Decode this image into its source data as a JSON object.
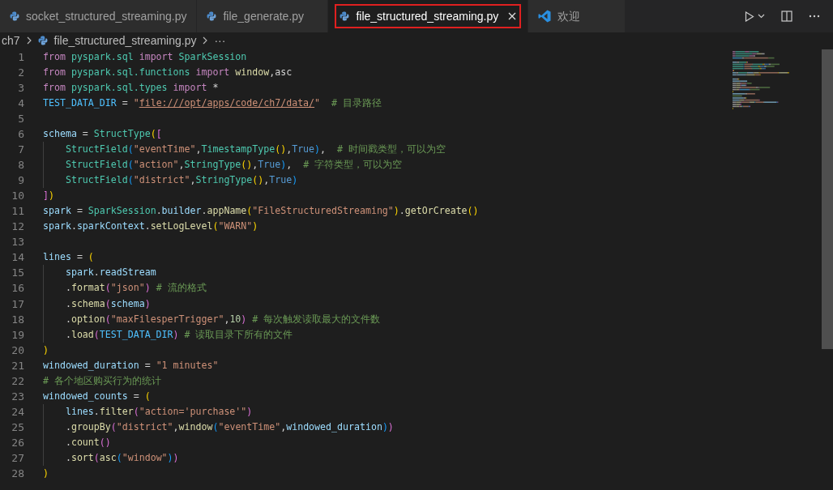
{
  "tabs": [
    {
      "label": "socket_structured_streaming.py",
      "kind": "file",
      "selected": false,
      "closable": false,
      "outlined": false
    },
    {
      "label": "file_generate.py",
      "kind": "file",
      "selected": false,
      "closable": false,
      "outlined": false
    },
    {
      "label": "file_structured_streaming.py",
      "kind": "file",
      "selected": true,
      "closable": true,
      "outlined": true
    },
    {
      "label": "欢迎",
      "kind": "welcome",
      "selected": false,
      "closable": false,
      "outlined": false
    }
  ],
  "breadcrumbs": {
    "folder": "ch7",
    "file": "file_structured_streaming.py",
    "more": "···"
  },
  "lines": [
    {
      "n": "1",
      "tokens": [
        {
          "t": "from",
          "kind": "kw"
        },
        {
          "t": " pyspark.sql ",
          "kind": "mod"
        },
        {
          "t": "import",
          "kind": "kw"
        },
        {
          "t": " SparkSession",
          "kind": "cls"
        }
      ]
    },
    {
      "n": "2",
      "tokens": [
        {
          "t": "from",
          "kind": "kw"
        },
        {
          "t": " pyspark.sql.functions ",
          "kind": "mod"
        },
        {
          "t": "import",
          "kind": "kw"
        },
        {
          "t": " window",
          "kind": "fn"
        },
        {
          "t": ",asc",
          "kind": "plain"
        }
      ]
    },
    {
      "n": "3",
      "tokens": [
        {
          "t": "from",
          "kind": "kw"
        },
        {
          "t": " pyspark.sql.types ",
          "kind": "mod"
        },
        {
          "t": "import",
          "kind": "kw"
        },
        {
          "t": " *",
          "kind": "plain"
        }
      ]
    },
    {
      "n": "4",
      "tokens": [
        {
          "t": "TEST_DATA_DIR",
          "kind": "const"
        },
        {
          "t": " = ",
          "kind": "plain"
        },
        {
          "t": "\"",
          "kind": "str"
        },
        {
          "t": "file:///opt/apps/code/ch7/data/",
          "kind": "link"
        },
        {
          "t": "\"",
          "kind": "str"
        },
        {
          "t": "  # 目录路径",
          "kind": "cm"
        }
      ]
    },
    {
      "n": "5"
    },
    {
      "n": "6",
      "tokens": [
        {
          "t": "schema",
          "kind": "var"
        },
        {
          "t": " = ",
          "kind": "plain"
        },
        {
          "t": "StructType",
          "kind": "cls"
        },
        {
          "t": "(",
          "kind": "b1"
        },
        {
          "t": "[",
          "kind": "b2"
        }
      ]
    },
    {
      "n": "7",
      "tokens": [
        {
          "t": "    StructField",
          "kind": "cls"
        },
        {
          "t": "(",
          "kind": "b3"
        },
        {
          "t": "\"eventTime\"",
          "kind": "str"
        },
        {
          "t": ",",
          "kind": "plain"
        },
        {
          "t": "TimestampType",
          "kind": "cls"
        },
        {
          "t": "()",
          "kind": "b1"
        },
        {
          "t": ",",
          "kind": "plain"
        },
        {
          "t": "True",
          "kind": "kwb"
        },
        {
          "t": ")",
          "kind": "b3"
        },
        {
          "t": ",  ",
          "kind": "plain"
        },
        {
          "t": "# 时间戳类型，可以为空",
          "kind": "cm"
        }
      ]
    },
    {
      "n": "8",
      "tokens": [
        {
          "t": "    StructField",
          "kind": "cls"
        },
        {
          "t": "(",
          "kind": "b3"
        },
        {
          "t": "\"action\"",
          "kind": "str"
        },
        {
          "t": ",",
          "kind": "plain"
        },
        {
          "t": "StringType",
          "kind": "cls"
        },
        {
          "t": "()",
          "kind": "b1"
        },
        {
          "t": ",",
          "kind": "plain"
        },
        {
          "t": "True",
          "kind": "kwb"
        },
        {
          "t": ")",
          "kind": "b3"
        },
        {
          "t": ",  ",
          "kind": "plain"
        },
        {
          "t": "# 字符类型，可以为空",
          "kind": "cm"
        }
      ]
    },
    {
      "n": "9",
      "tokens": [
        {
          "t": "    StructField",
          "kind": "cls"
        },
        {
          "t": "(",
          "kind": "b3"
        },
        {
          "t": "\"district\"",
          "kind": "str"
        },
        {
          "t": ",",
          "kind": "plain"
        },
        {
          "t": "StringType",
          "kind": "cls"
        },
        {
          "t": "()",
          "kind": "b1"
        },
        {
          "t": ",",
          "kind": "plain"
        },
        {
          "t": "True",
          "kind": "kwb"
        },
        {
          "t": ")",
          "kind": "b3"
        }
      ]
    },
    {
      "n": "10",
      "tokens": [
        {
          "t": "]",
          "kind": "b2"
        },
        {
          "t": ")",
          "kind": "b1"
        }
      ]
    },
    {
      "n": "11",
      "tokens": [
        {
          "t": "spark",
          "kind": "var"
        },
        {
          "t": " = ",
          "kind": "plain"
        },
        {
          "t": "SparkSession",
          "kind": "cls"
        },
        {
          "t": ".",
          "kind": "plain"
        },
        {
          "t": "builder",
          "kind": "var"
        },
        {
          "t": ".",
          "kind": "plain"
        },
        {
          "t": "appName",
          "kind": "fn"
        },
        {
          "t": "(",
          "kind": "b1"
        },
        {
          "t": "\"FileStructuredStreaming\"",
          "kind": "str"
        },
        {
          "t": ")",
          "kind": "b1"
        },
        {
          "t": ".",
          "kind": "plain"
        },
        {
          "t": "getOrCreate",
          "kind": "fn"
        },
        {
          "t": "()",
          "kind": "b1"
        }
      ]
    },
    {
      "n": "12",
      "tokens": [
        {
          "t": "spark",
          "kind": "var"
        },
        {
          "t": ".",
          "kind": "plain"
        },
        {
          "t": "sparkContext",
          "kind": "var"
        },
        {
          "t": ".",
          "kind": "plain"
        },
        {
          "t": "setLogLevel",
          "kind": "fn"
        },
        {
          "t": "(",
          "kind": "b1"
        },
        {
          "t": "\"WARN\"",
          "kind": "str"
        },
        {
          "t": ")",
          "kind": "b1"
        }
      ]
    },
    {
      "n": "13"
    },
    {
      "n": "14",
      "tokens": [
        {
          "t": "lines",
          "kind": "var"
        },
        {
          "t": " = ",
          "kind": "plain"
        },
        {
          "t": "(",
          "kind": "b1"
        }
      ]
    },
    {
      "n": "15",
      "tokens": [
        {
          "t": "    spark",
          "kind": "var"
        },
        {
          "t": ".",
          "kind": "plain"
        },
        {
          "t": "readStream",
          "kind": "var"
        }
      ]
    },
    {
      "n": "16",
      "tokens": [
        {
          "t": "    .",
          "kind": "plain"
        },
        {
          "t": "format",
          "kind": "fn"
        },
        {
          "t": "(",
          "kind": "b2"
        },
        {
          "t": "\"json\"",
          "kind": "str"
        },
        {
          "t": ")",
          "kind": "b2"
        },
        {
          "t": " # 流的格式",
          "kind": "cm"
        }
      ]
    },
    {
      "n": "17",
      "tokens": [
        {
          "t": "    .",
          "kind": "plain"
        },
        {
          "t": "schema",
          "kind": "fn"
        },
        {
          "t": "(",
          "kind": "b2"
        },
        {
          "t": "schema",
          "kind": "var"
        },
        {
          "t": ")",
          "kind": "b2"
        }
      ]
    },
    {
      "n": "18",
      "tokens": [
        {
          "t": "    .",
          "kind": "plain"
        },
        {
          "t": "option",
          "kind": "fn"
        },
        {
          "t": "(",
          "kind": "b2"
        },
        {
          "t": "\"maxFilesperTrigger\"",
          "kind": "str"
        },
        {
          "t": ",",
          "kind": "plain"
        },
        {
          "t": "10",
          "kind": "num"
        },
        {
          "t": ")",
          "kind": "b2"
        },
        {
          "t": " # 每次触发读取最大的文件数",
          "kind": "cm"
        }
      ]
    },
    {
      "n": "19",
      "tokens": [
        {
          "t": "    .",
          "kind": "plain"
        },
        {
          "t": "load",
          "kind": "fn"
        },
        {
          "t": "(",
          "kind": "b2"
        },
        {
          "t": "TEST_DATA_DIR",
          "kind": "const"
        },
        {
          "t": ")",
          "kind": "b2"
        },
        {
          "t": " # 读取目录下所有的文件",
          "kind": "cm"
        }
      ]
    },
    {
      "n": "20",
      "tokens": [
        {
          "t": ")",
          "kind": "b1"
        }
      ]
    },
    {
      "n": "21",
      "tokens": [
        {
          "t": "windowed_duration",
          "kind": "var"
        },
        {
          "t": " = ",
          "kind": "plain"
        },
        {
          "t": "\"1 minutes\"",
          "kind": "str"
        }
      ]
    },
    {
      "n": "22",
      "tokens": [
        {
          "t": "# 各个地区购买行为的统计",
          "kind": "cm"
        }
      ]
    },
    {
      "n": "23",
      "tokens": [
        {
          "t": "windowed_counts",
          "kind": "var"
        },
        {
          "t": " = ",
          "kind": "plain"
        },
        {
          "t": "(",
          "kind": "b1"
        }
      ]
    },
    {
      "n": "24",
      "tokens": [
        {
          "t": "    lines",
          "kind": "var"
        },
        {
          "t": ".",
          "kind": "plain"
        },
        {
          "t": "filter",
          "kind": "fn"
        },
        {
          "t": "(",
          "kind": "b2"
        },
        {
          "t": "\"action='purchase'\"",
          "kind": "str"
        },
        {
          "t": ")",
          "kind": "b2"
        }
      ]
    },
    {
      "n": "25",
      "tokens": [
        {
          "t": "    .",
          "kind": "plain"
        },
        {
          "t": "groupBy",
          "kind": "fn"
        },
        {
          "t": "(",
          "kind": "b2"
        },
        {
          "t": "\"district\"",
          "kind": "str"
        },
        {
          "t": ",",
          "kind": "plain"
        },
        {
          "t": "window",
          "kind": "fn"
        },
        {
          "t": "(",
          "kind": "b3"
        },
        {
          "t": "\"eventTime\"",
          "kind": "str"
        },
        {
          "t": ",",
          "kind": "plain"
        },
        {
          "t": "windowed_duration",
          "kind": "var"
        },
        {
          "t": ")",
          "kind": "b3"
        },
        {
          "t": ")",
          "kind": "b2"
        }
      ]
    },
    {
      "n": "26",
      "tokens": [
        {
          "t": "    .",
          "kind": "plain"
        },
        {
          "t": "count",
          "kind": "fn"
        },
        {
          "t": "()",
          "kind": "b2"
        }
      ]
    },
    {
      "n": "27",
      "tokens": [
        {
          "t": "    .",
          "kind": "plain"
        },
        {
          "t": "sort",
          "kind": "fn"
        },
        {
          "t": "(",
          "kind": "b2"
        },
        {
          "t": "asc",
          "kind": "fn"
        },
        {
          "t": "(",
          "kind": "b3"
        },
        {
          "t": "\"window\"",
          "kind": "str"
        },
        {
          "t": ")",
          "kind": "b3"
        },
        {
          "t": ")",
          "kind": "b2"
        }
      ]
    },
    {
      "n": "28",
      "tokens": [
        {
          "t": ")",
          "kind": "b1"
        }
      ]
    }
  ]
}
